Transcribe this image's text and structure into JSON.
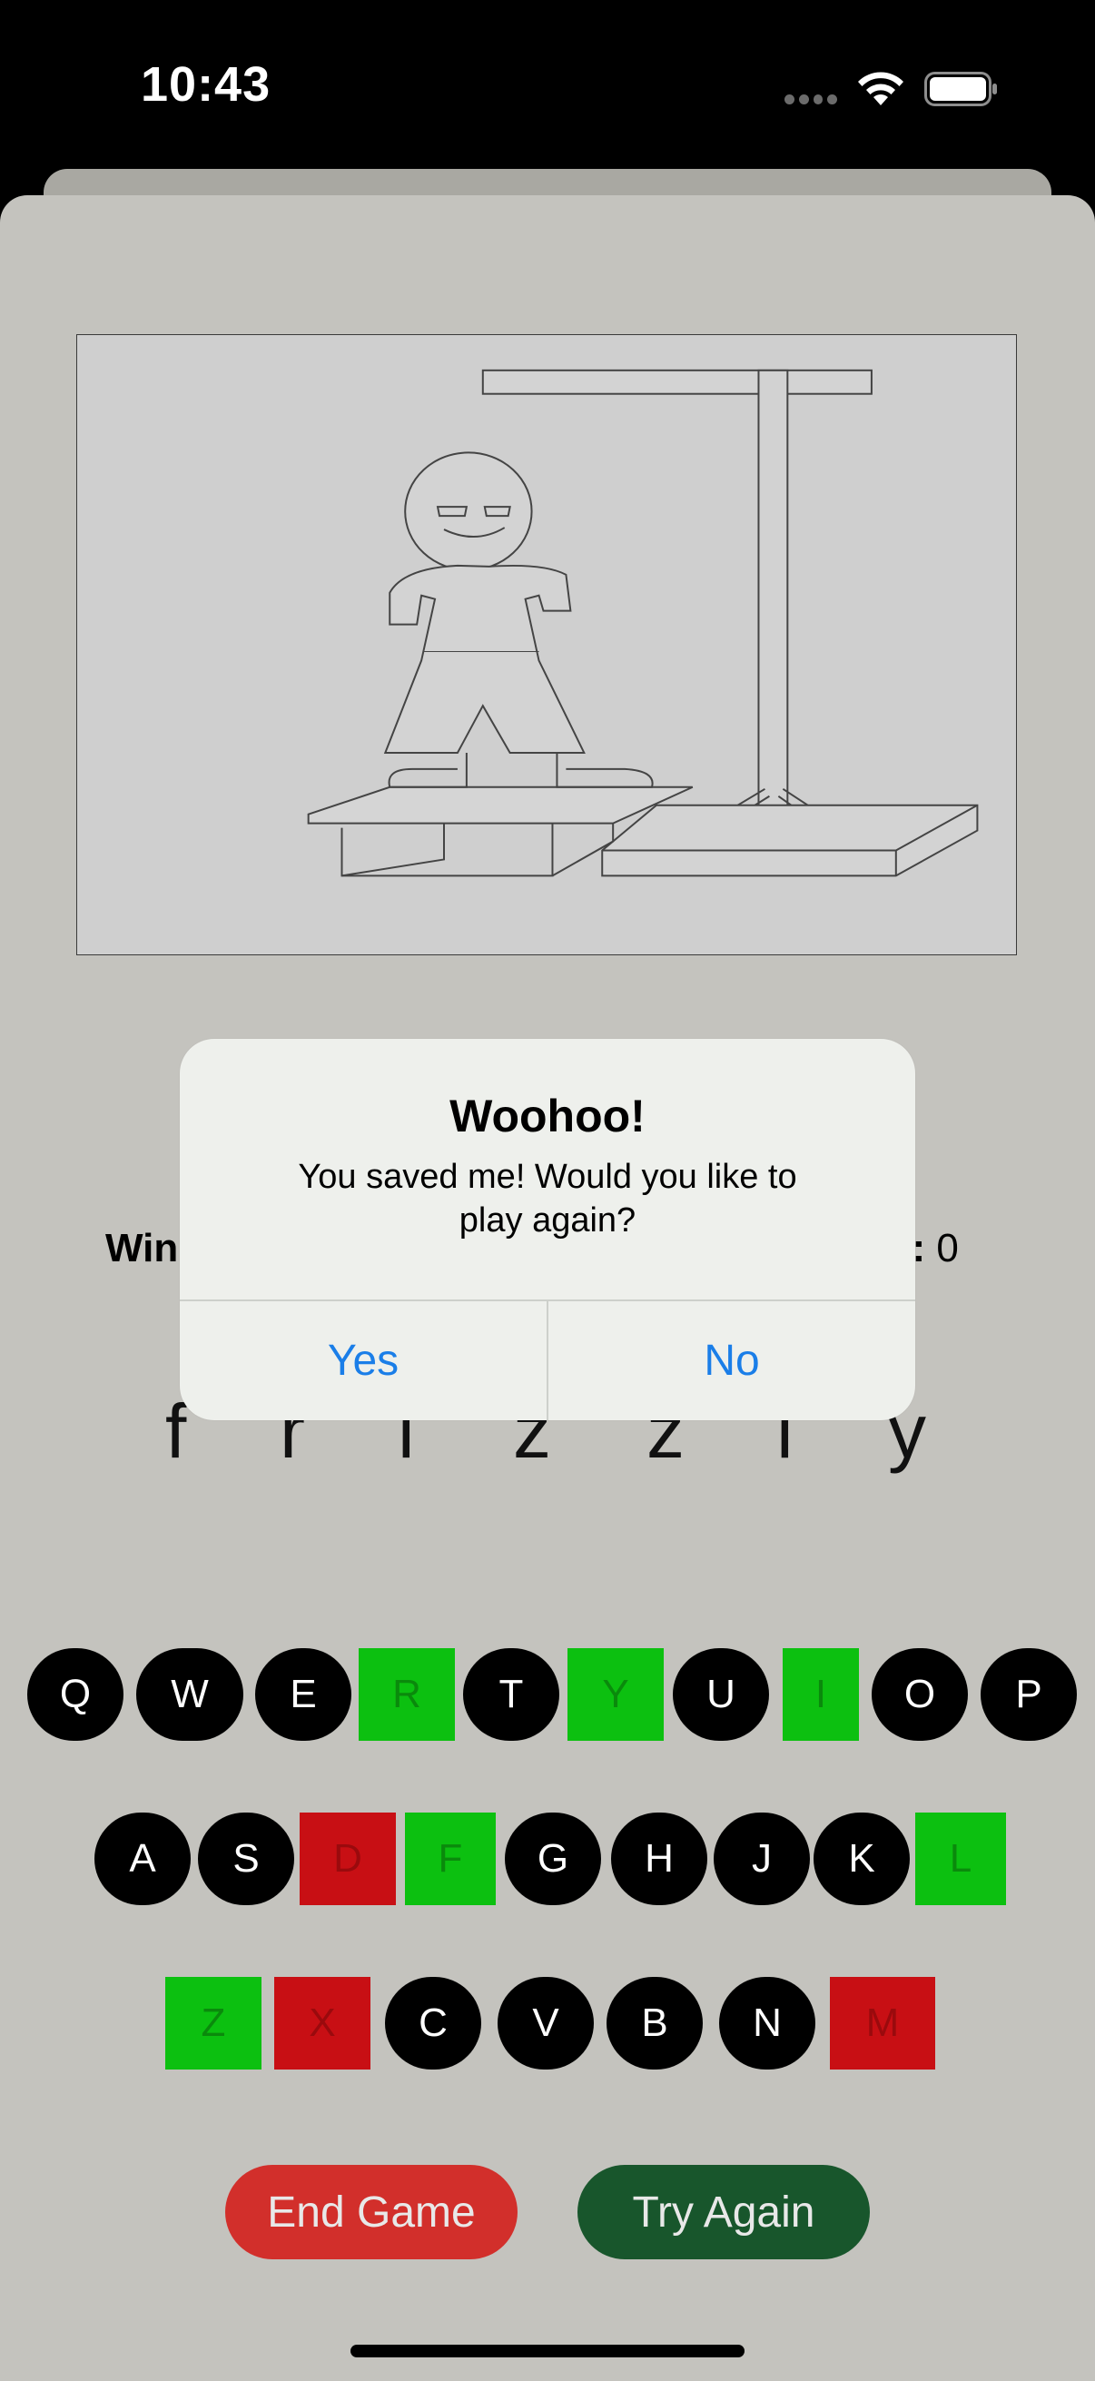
{
  "status": {
    "time": "10:43"
  },
  "alert": {
    "title": "Woohoo!",
    "message": "You saved me! Would you like to play again?",
    "yes": "Yes",
    "no": "No"
  },
  "score": {
    "wins_label": "Win",
    "losses_label": "s:",
    "losses_value": "0"
  },
  "word": {
    "letters": [
      "f",
      "r",
      "i",
      "z",
      "z",
      "l",
      "y"
    ]
  },
  "keyboard": {
    "row1": [
      {
        "letter": "Q",
        "state": "unused"
      },
      {
        "letter": "W",
        "state": "unused"
      },
      {
        "letter": "E",
        "state": "unused"
      },
      {
        "letter": "R",
        "state": "correct"
      },
      {
        "letter": "T",
        "state": "unused"
      },
      {
        "letter": "Y",
        "state": "correct"
      },
      {
        "letter": "U",
        "state": "unused"
      },
      {
        "letter": "I",
        "state": "correct"
      },
      {
        "letter": "O",
        "state": "unused"
      },
      {
        "letter": "P",
        "state": "unused"
      }
    ],
    "row2": [
      {
        "letter": "A",
        "state": "unused"
      },
      {
        "letter": "S",
        "state": "unused"
      },
      {
        "letter": "D",
        "state": "wrong"
      },
      {
        "letter": "F",
        "state": "correct"
      },
      {
        "letter": "G",
        "state": "unused"
      },
      {
        "letter": "H",
        "state": "unused"
      },
      {
        "letter": "J",
        "state": "unused"
      },
      {
        "letter": "K",
        "state": "unused"
      },
      {
        "letter": "L",
        "state": "correct"
      }
    ],
    "row3": [
      {
        "letter": "Z",
        "state": "correct"
      },
      {
        "letter": "X",
        "state": "wrong"
      },
      {
        "letter": "C",
        "state": "unused"
      },
      {
        "letter": "V",
        "state": "unused"
      },
      {
        "letter": "B",
        "state": "unused"
      },
      {
        "letter": "N",
        "state": "unused"
      },
      {
        "letter": "M",
        "state": "wrong"
      }
    ]
  },
  "buttons": {
    "end_game": "End Game",
    "try_again": "Try Again"
  },
  "colors": {
    "correct": "#0cc010",
    "wrong": "#c80f14",
    "unused": "#000000",
    "end_game": "#d22f2b",
    "try_again": "#18562c",
    "alert_button": "#1a7ee8"
  },
  "icons": [
    "wifi-icon",
    "battery-icon",
    "cellular-dots-icon",
    "hangman-drawing"
  ]
}
